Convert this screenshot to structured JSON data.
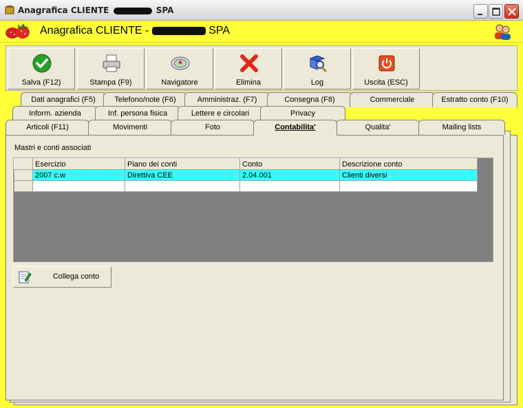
{
  "window": {
    "title_prefix": "Anagrafica CLIENTE",
    "title_suffix": "SPA"
  },
  "header": {
    "title": "Anagrafica CLIENTE - ",
    "title_suffix": "SPA"
  },
  "toolbar": {
    "buttons": [
      {
        "label": "Salva (F12)",
        "icon": "check-icon"
      },
      {
        "label": "Stampa (F9)",
        "icon": "printer-icon"
      },
      {
        "label": "Navigatore",
        "icon": "compass-icon"
      },
      {
        "label": "Elimina",
        "icon": "delete-x-icon"
      },
      {
        "label": "Log",
        "icon": "log-search-icon"
      },
      {
        "label": "Uscita (ESC)",
        "icon": "power-icon"
      }
    ]
  },
  "tabs": {
    "row1": [
      "Dati anagrafici (F5)",
      "Telefono/note (F6)",
      "Amministraz. (F7)",
      "Consegna (F8)",
      "Commerciale",
      "Estratto conto (F10)"
    ],
    "row2": [
      "Inform. azienda",
      "Inf. persona fisica",
      "Lettere e circolari",
      "Privacy"
    ],
    "row3": [
      "Articoli (F11)",
      "Movimenti",
      "Foto",
      "Contabilita'",
      "Qualita'",
      "Mailing lists"
    ],
    "active": "Contabilita'"
  },
  "panel": {
    "section_label": "Mastri e conti associati",
    "columns": [
      "Esercizio",
      "Piano dei conti",
      "Conto",
      "Descrizione conto"
    ],
    "rows": [
      [
        "2007 c.w",
        "Direttiva CEE",
        "2.04.001",
        "Clienti diversi"
      ]
    ],
    "collega_label": "Collega conto"
  },
  "colors": {
    "accent_yellow": "#ffff3a",
    "selected_row": "#33ffff",
    "grid_bg": "#808080"
  }
}
